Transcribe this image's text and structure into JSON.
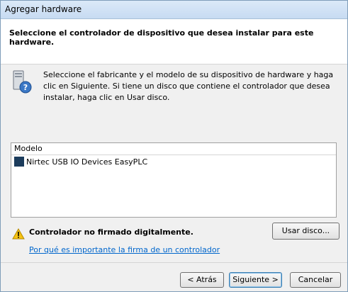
{
  "window": {
    "title": "Agregar hardware"
  },
  "header": {
    "text": "Seleccione el controlador de dispositivo que desea instalar para este hardware."
  },
  "info": {
    "text": "Seleccione el fabricante y el modelo de su dispositivo de hardware y haga clic en Siguiente. Si tiene un disco que contiene el controlador que desea instalar, haga clic en  Usar disco.",
    "icon": "hardware-help-icon"
  },
  "models": {
    "header": "Modelo",
    "items": [
      {
        "label": "Nirtec USB IO Devices EasyPLC"
      }
    ]
  },
  "warning": {
    "text": "Controlador no firmado digitalmente.",
    "icon": "warning-icon",
    "link": "Por qué es importante la firma de un controlador"
  },
  "buttons": {
    "usar_disco": "Usar disco...",
    "atras": "< Atrás",
    "siguiente": "Siguiente >",
    "cancelar": "Cancelar"
  },
  "colors": {
    "link": "#0066cc",
    "model_icon": "#1c3c5c"
  }
}
